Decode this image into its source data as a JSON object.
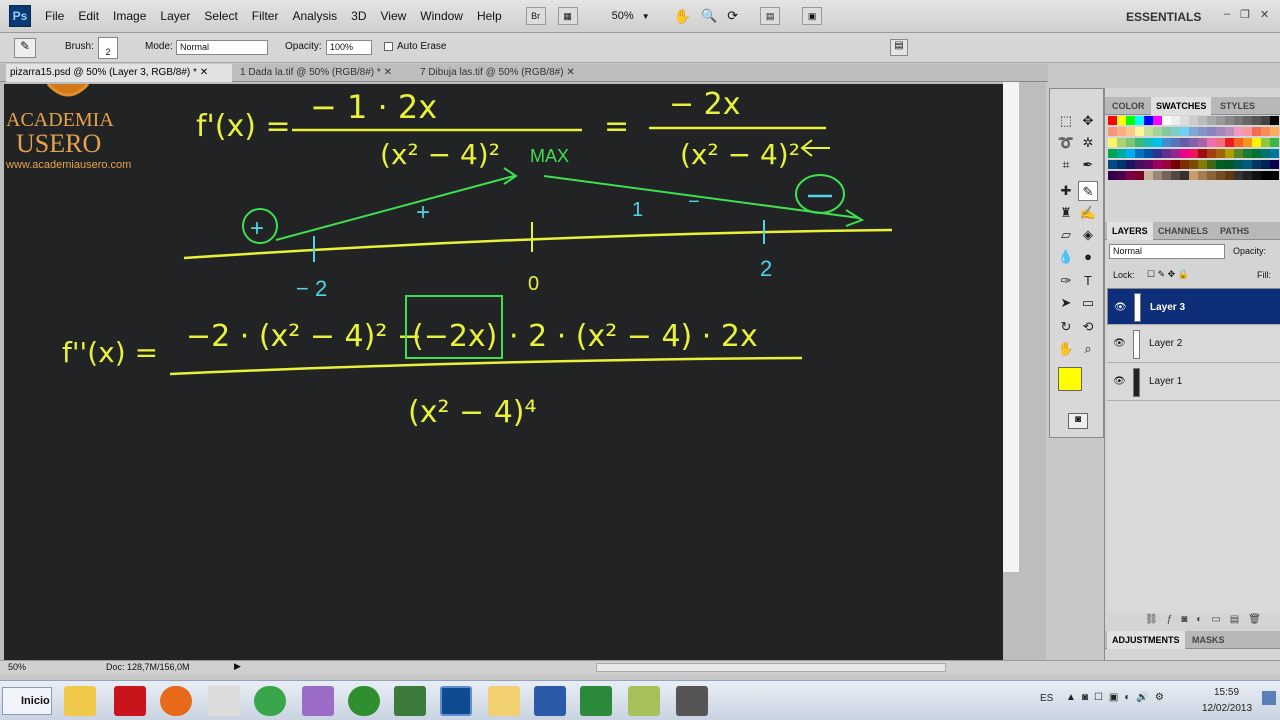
{
  "app": {
    "logo": "Ps"
  },
  "menu": [
    "File",
    "Edit",
    "Image",
    "Layer",
    "Select",
    "Filter",
    "Analysis",
    "3D",
    "View",
    "Window",
    "Help"
  ],
  "toolbar": {
    "br_label": "Br",
    "zoom": "50%"
  },
  "workspace": {
    "name": "ESSENTIALS"
  },
  "options": {
    "brush_label": "Brush:",
    "brush_size": "2",
    "mode_label": "Mode:",
    "mode_value": "Normal",
    "opacity_label": "Opacity:",
    "opacity_value": "100%",
    "auto_erase": "Auto Erase"
  },
  "tabs": [
    "pizarra15.psd @ 50% (Layer 3, RGB/8#) *",
    "1 Dada la.tif @ 50% (RGB/8#) *",
    "7 Dibuja las.tif @ 50% (RGB/8#)"
  ],
  "logo": {
    "line1": "ACADEMIA",
    "line2": "USERO",
    "url": "www.academiausero.com"
  },
  "board": {
    "eq1_lhs": "f'(x) =",
    "eq1_num": "− 1 · 2x",
    "eq1_den": "(x² − 4)²",
    "eq1_eq": "=",
    "eq1_num2": "− 2x",
    "eq1_den2": "(x² − 4)²",
    "max_label": "MAX",
    "sign_plus1": "+",
    "sign_plus2": "+",
    "sign_one": "1",
    "sign_minus": "−",
    "tick_m2": "− 2",
    "tick_0": "0",
    "tick_2": "2",
    "eq2_lhs": "f''(x) =",
    "eq2_num_a": "−2 · (x² − 4)² −",
    "eq2_box": "(−2x)",
    "eq2_num_b": "· 2 · (x² − 4) · 2x",
    "eq2_den": "(x² − 4)⁴"
  },
  "panels": {
    "top_tabs": [
      "COLOR",
      "SWATCHES",
      "STYLES"
    ],
    "layer_tabs": [
      "LAYERS",
      "CHANNELS",
      "PATHS"
    ],
    "blend_mode": "Normal",
    "opacity_label": "Opacity:",
    "lock_label": "Lock:",
    "fill_label": "Fill:",
    "layers": [
      "Layer 3",
      "Layer 2",
      "Layer 1"
    ],
    "bottom_tabs": [
      "ADJUSTMENTS",
      "MASKS"
    ]
  },
  "status": {
    "zoom": "50%",
    "doc": "Doc: 128,7M/156,0M"
  },
  "taskbar": {
    "start": "Inicio",
    "lang": "ES",
    "time": "15:59",
    "date": "12/02/2013"
  },
  "colors": {
    "chalk_yellow": "#e8f23a",
    "chalk_green": "#3fe050",
    "chalk_cyan": "#4fd4e6",
    "layer_selected": "#0d2f7a",
    "foreground": "#ffff00",
    "background": "#000000"
  }
}
